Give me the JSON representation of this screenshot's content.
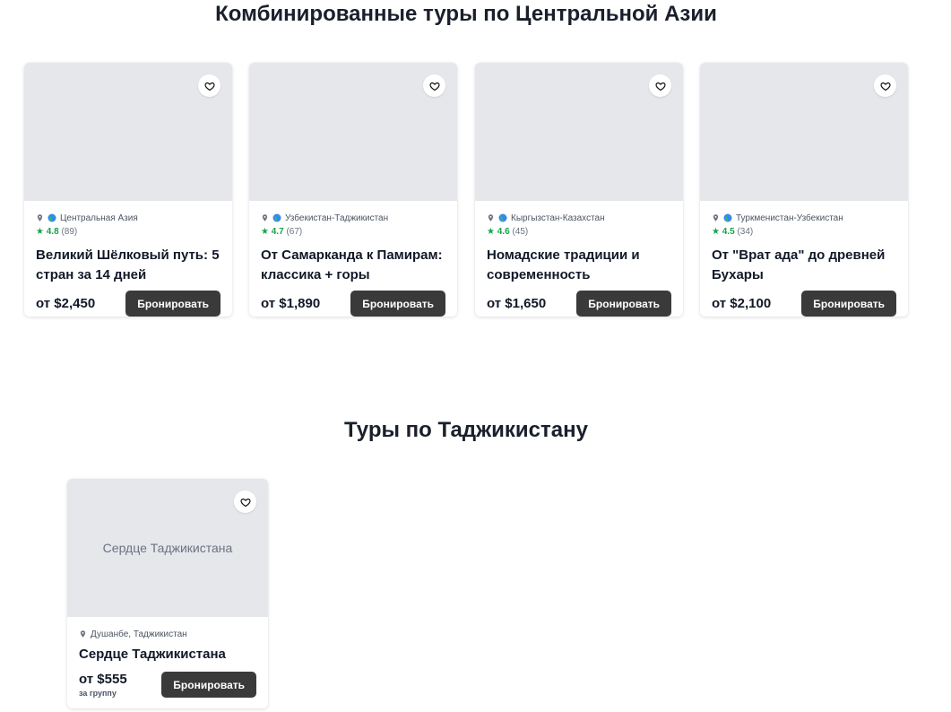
{
  "sections": {
    "combined_title": "Комбинированные туры по Центральной Азии",
    "tajik_title": "Туры по Таджикистану"
  },
  "combined_tours": [
    {
      "location": "Центральная Азия",
      "rating": "4.8",
      "reviews": "(89)",
      "title": "Великий Шёлковый путь: 5 стран за 14 дней",
      "price": "от $2,450",
      "book_label": "Бронировать"
    },
    {
      "location": "Узбекистан-Таджикистан",
      "rating": "4.7",
      "reviews": "(67)",
      "title": "От Самарканда к Памирам: классика + горы",
      "price": "от $1,890",
      "book_label": "Бронировать"
    },
    {
      "location": "Кыргызстан-Казахстан",
      "rating": "4.6",
      "reviews": "(45)",
      "title": "Номадские традиции и современность",
      "price": "от $1,650",
      "book_label": "Бронировать"
    },
    {
      "location": "Туркменистан-Узбекистан",
      "rating": "4.5",
      "reviews": "(34)",
      "title": "От \"Врат ада\" до древней Бухары",
      "price": "от $2,100",
      "book_label": "Бронировать"
    }
  ],
  "tajik_tours": [
    {
      "image_caption": "Сердце Таджикистана",
      "location": "Душанбе, Таджикистан",
      "title": "Сердце Таджикистана",
      "price": "от $555",
      "price_note": "за группу",
      "book_label": "Бронировать"
    }
  ],
  "icons": {
    "favorite": "heart-icon",
    "location": "map-pin-icon",
    "region": "globe-icon",
    "rating": "star-icon"
  },
  "colors": {
    "accent_rating": "#16a34a",
    "button_bg": "#3a3a3a",
    "image_placeholder": "#e5e7eb"
  }
}
